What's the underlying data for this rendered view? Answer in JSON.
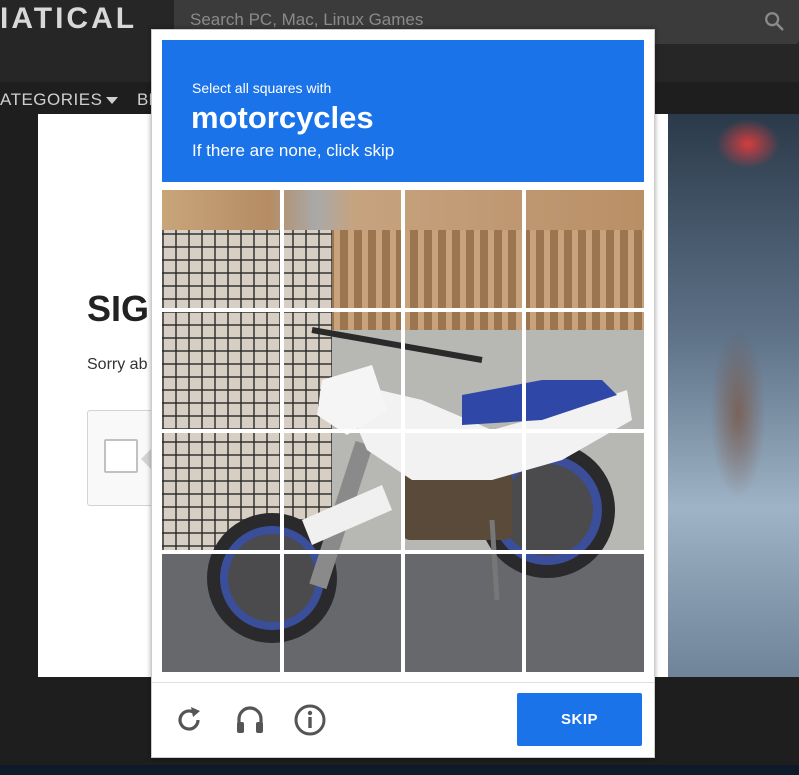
{
  "site": {
    "brand": "IATICAL",
    "search_placeholder": "Search PC, Mac, Linux Games",
    "nav_categories": "ATEGORIES",
    "nav_next": "BI",
    "signin_title": "SIG",
    "signin_sorry": "Sorry ab"
  },
  "captcha": {
    "instruction": "Select all squares with",
    "target": "motorcycles",
    "subtext": "If there are none, click skip",
    "skip_label": "SKIP",
    "grid": {
      "rows": 4,
      "cols": 4
    },
    "icons": [
      "reload-icon",
      "audio-icon",
      "info-icon"
    ]
  },
  "colors": {
    "captcha_blue": "#1a73e8",
    "page_dark": "#262626"
  }
}
